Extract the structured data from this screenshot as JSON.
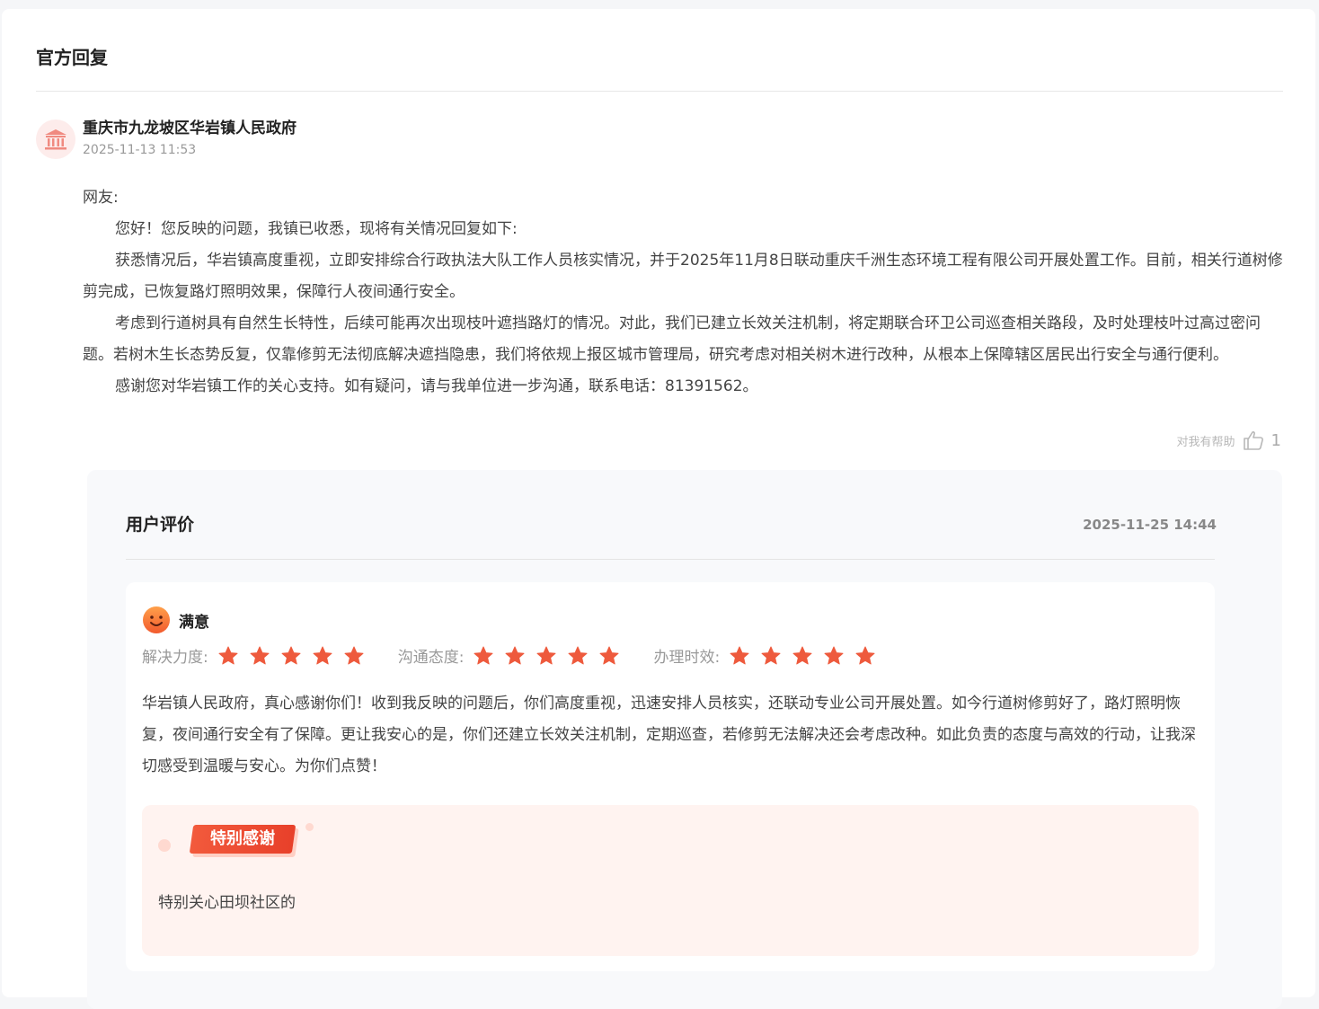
{
  "reply": {
    "section_title": "官方回复",
    "org_name": "重庆市九龙坡区华岩镇人民政府",
    "time": "2025-11-13 11:53",
    "greeting": "网友:",
    "paragraphs": [
      "您好！您反映的问题，我镇已收悉，现将有关情况回复如下:",
      "获悉情况后，华岩镇高度重视，立即安排综合行政执法大队工作人员核实情况，并于2025年11月8日联动重庆千洲生态环境工程有限公司开展处置工作。目前，相关行道树修剪完成，已恢复路灯照明效果，保障行人夜间通行安全。",
      "考虑到行道树具有自然生长特性，后续可能再次出现枝叶遮挡路灯的情况。对此，我们已建立长效关注机制，将定期联合环卫公司巡查相关路段，及时处理枝叶过高过密问题。若树木生长态势反复，仅靠修剪无法彻底解决遮挡隐患，我们将依规上报区城市管理局，研究考虑对相关树木进行改种，从根本上保障辖区居民出行安全与通行便利。",
      "感谢您对华岩镇工作的关心支持。如有疑问，请与我单位进一步沟通，联系电话：81391562。"
    ],
    "helpful_label": "对我有帮助",
    "helpful_count": "1"
  },
  "evaluation": {
    "title": "用户评价",
    "date": "2025-11-25 14:44",
    "satisfaction": "满意",
    "ratings": [
      {
        "label": "解决力度:",
        "stars": 5
      },
      {
        "label": "沟通态度:",
        "stars": 5
      },
      {
        "label": "办理时效:",
        "stars": 5
      }
    ],
    "comment": "华岩镇人民政府，真心感谢你们！收到我反映的问题后，你们高度重视，迅速安排人员核实，还联动专业公司开展处置。如今行道树修剪好了，路灯照明恢复，夜间通行安全有了保障。更让我安心的是，你们还建立长效关注机制，定期巡查，若修剪无法解决还会考虑改种。如此负责的态度与高效的行动，让我深切感受到温暖与安心。为你们点赞！",
    "thanks_tag": "特别感谢",
    "thanks_text": "特别关心田坝社区的"
  },
  "colors": {
    "accent_red": "#f0523a",
    "star": "#ee5a3d",
    "smiley": "#ff7a3d"
  },
  "icons": {
    "org_avatar": "government-building-icon",
    "helpful": "thumbs-up-icon",
    "satisfaction": "smiley-face-icon",
    "rating": "star-icon"
  }
}
